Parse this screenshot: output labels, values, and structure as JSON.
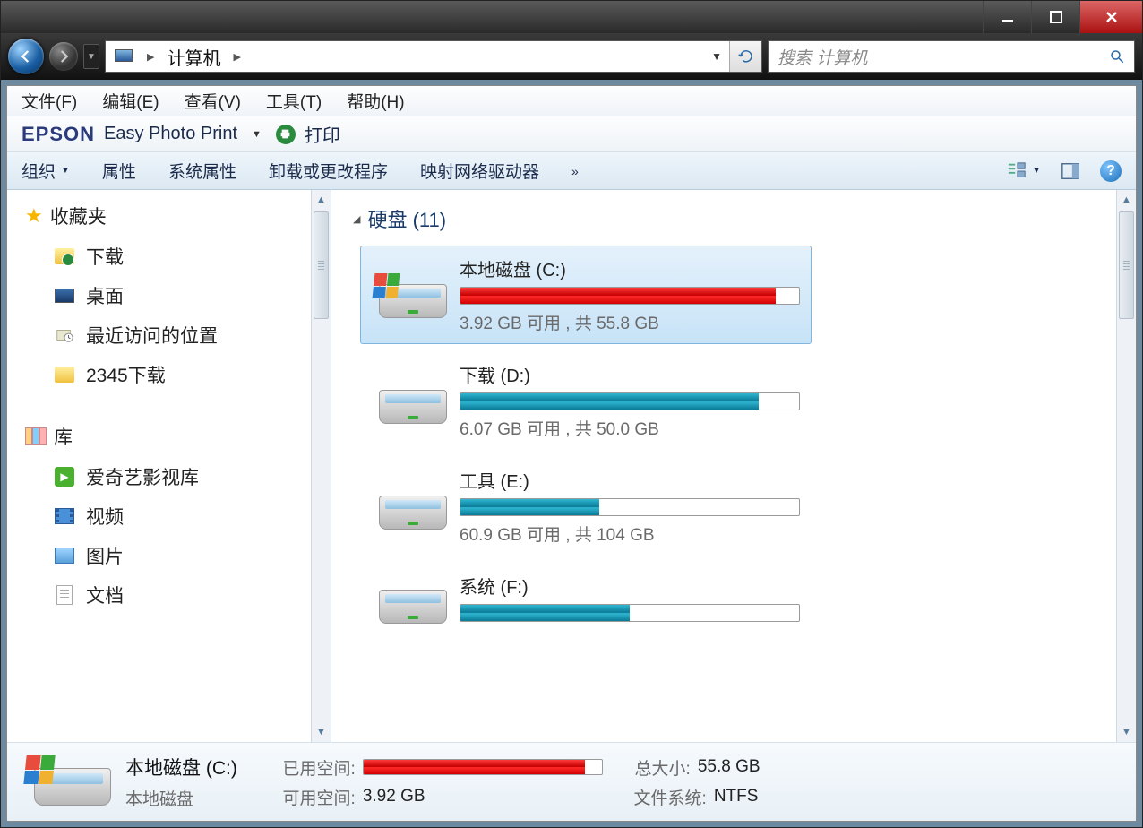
{
  "titlebar": {
    "minimize": "–",
    "maximize": "☐",
    "close": "✕"
  },
  "nav": {
    "location": "计算机",
    "search_placeholder": "搜索 计算机"
  },
  "menubar": {
    "file": "文件(F)",
    "edit": "编辑(E)",
    "view": "查看(V)",
    "tools": "工具(T)",
    "help": "帮助(H)"
  },
  "epson": {
    "brand": "EPSON",
    "product": "Easy Photo Print",
    "print": "打印"
  },
  "toolbar": {
    "organize": "组织",
    "properties": "属性",
    "sysprops": "系统属性",
    "uninstall": "卸载或更改程序",
    "mapdrive": "映射网络驱动器",
    "overflow": "»",
    "help": "?"
  },
  "sidebar": {
    "favorites": "收藏夹",
    "fav_items": {
      "downloads": "下载",
      "desktop": "桌面",
      "recent": "最近访问的位置",
      "dl2345": "2345下载"
    },
    "libraries": "库",
    "lib_items": {
      "iqiyi": "爱奇艺影视库",
      "videos": "视频",
      "pictures": "图片",
      "documents": "文档"
    }
  },
  "section": {
    "head": "硬盘 (11)"
  },
  "drives": [
    {
      "name": "本地磁盘 (C:)",
      "sub": "3.92 GB 可用 , 共 55.8 GB",
      "pct": 93,
      "color": "red",
      "win": true
    },
    {
      "name": "下载 (D:)",
      "sub": "6.07 GB 可用 , 共 50.0 GB",
      "pct": 88,
      "color": "teal",
      "win": false
    },
    {
      "name": "工具 (E:)",
      "sub": "60.9 GB 可用 , 共 104 GB",
      "pct": 41,
      "color": "teal",
      "win": false
    },
    {
      "name": "系统 (F:)",
      "sub": "",
      "pct": 50,
      "color": "teal",
      "win": false
    }
  ],
  "details": {
    "title": "本地磁盘 (C:)",
    "type": "本地磁盘",
    "used_label": "已用空间:",
    "free_label": "可用空间:",
    "free_val": "3.92 GB",
    "total_label": "总大小:",
    "total_val": "55.8 GB",
    "fs_label": "文件系统:",
    "fs_val": "NTFS",
    "used_pct": 93
  }
}
